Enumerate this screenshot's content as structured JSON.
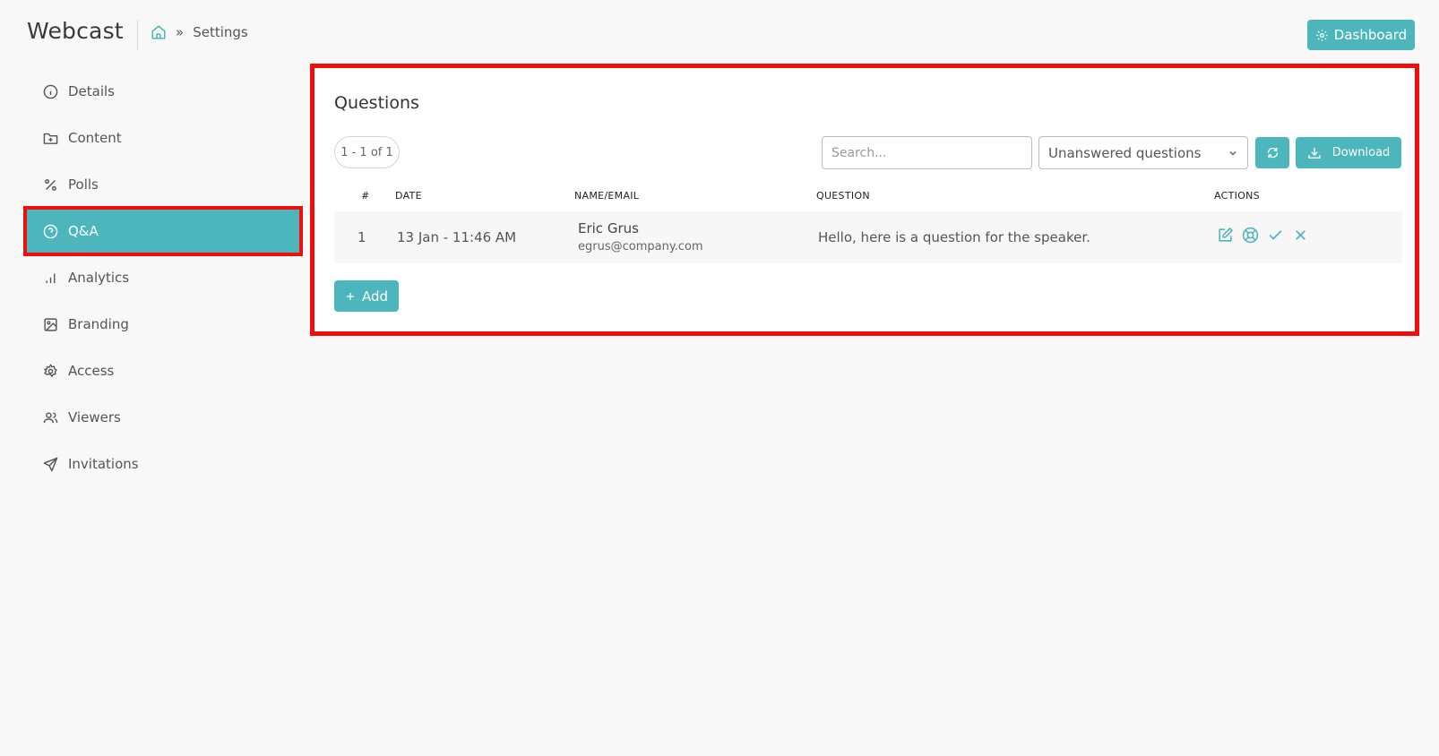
{
  "header": {
    "title": "Webcast",
    "breadcrumb_separator": "»",
    "breadcrumb_current": "Settings",
    "dashboard_label": "Dashboard"
  },
  "sidebar": {
    "items": [
      {
        "label": "Details",
        "icon": "info-icon"
      },
      {
        "label": "Content",
        "icon": "folder-plus-icon"
      },
      {
        "label": "Polls",
        "icon": "percent-icon"
      },
      {
        "label": "Q&A",
        "icon": "question-circle-icon",
        "active": true
      },
      {
        "label": "Analytics",
        "icon": "bar-chart-icon"
      },
      {
        "label": "Branding",
        "icon": "image-icon"
      },
      {
        "label": "Access",
        "icon": "gear-icon"
      },
      {
        "label": "Viewers",
        "icon": "users-icon"
      },
      {
        "label": "Invitations",
        "icon": "send-icon"
      }
    ]
  },
  "questions": {
    "title": "Questions",
    "count_label": "1 - 1 of 1",
    "search_placeholder": "Search...",
    "filter_selected": "Unanswered questions",
    "download_label": "Download",
    "add_label": "Add",
    "columns": {
      "num": "#",
      "date": "DATE",
      "name": "NAME/EMAIL",
      "question": "QUESTION",
      "actions": "ACTIONS"
    },
    "rows": [
      {
        "num": "1",
        "date": "13 Jan - 11:46 AM",
        "name": "Eric Grus",
        "email": "egrus@company.com",
        "question": "Hello, here is a question for the speaker."
      }
    ]
  },
  "colors": {
    "accent": "#4db6bc",
    "highlight": "#f20d0d"
  }
}
